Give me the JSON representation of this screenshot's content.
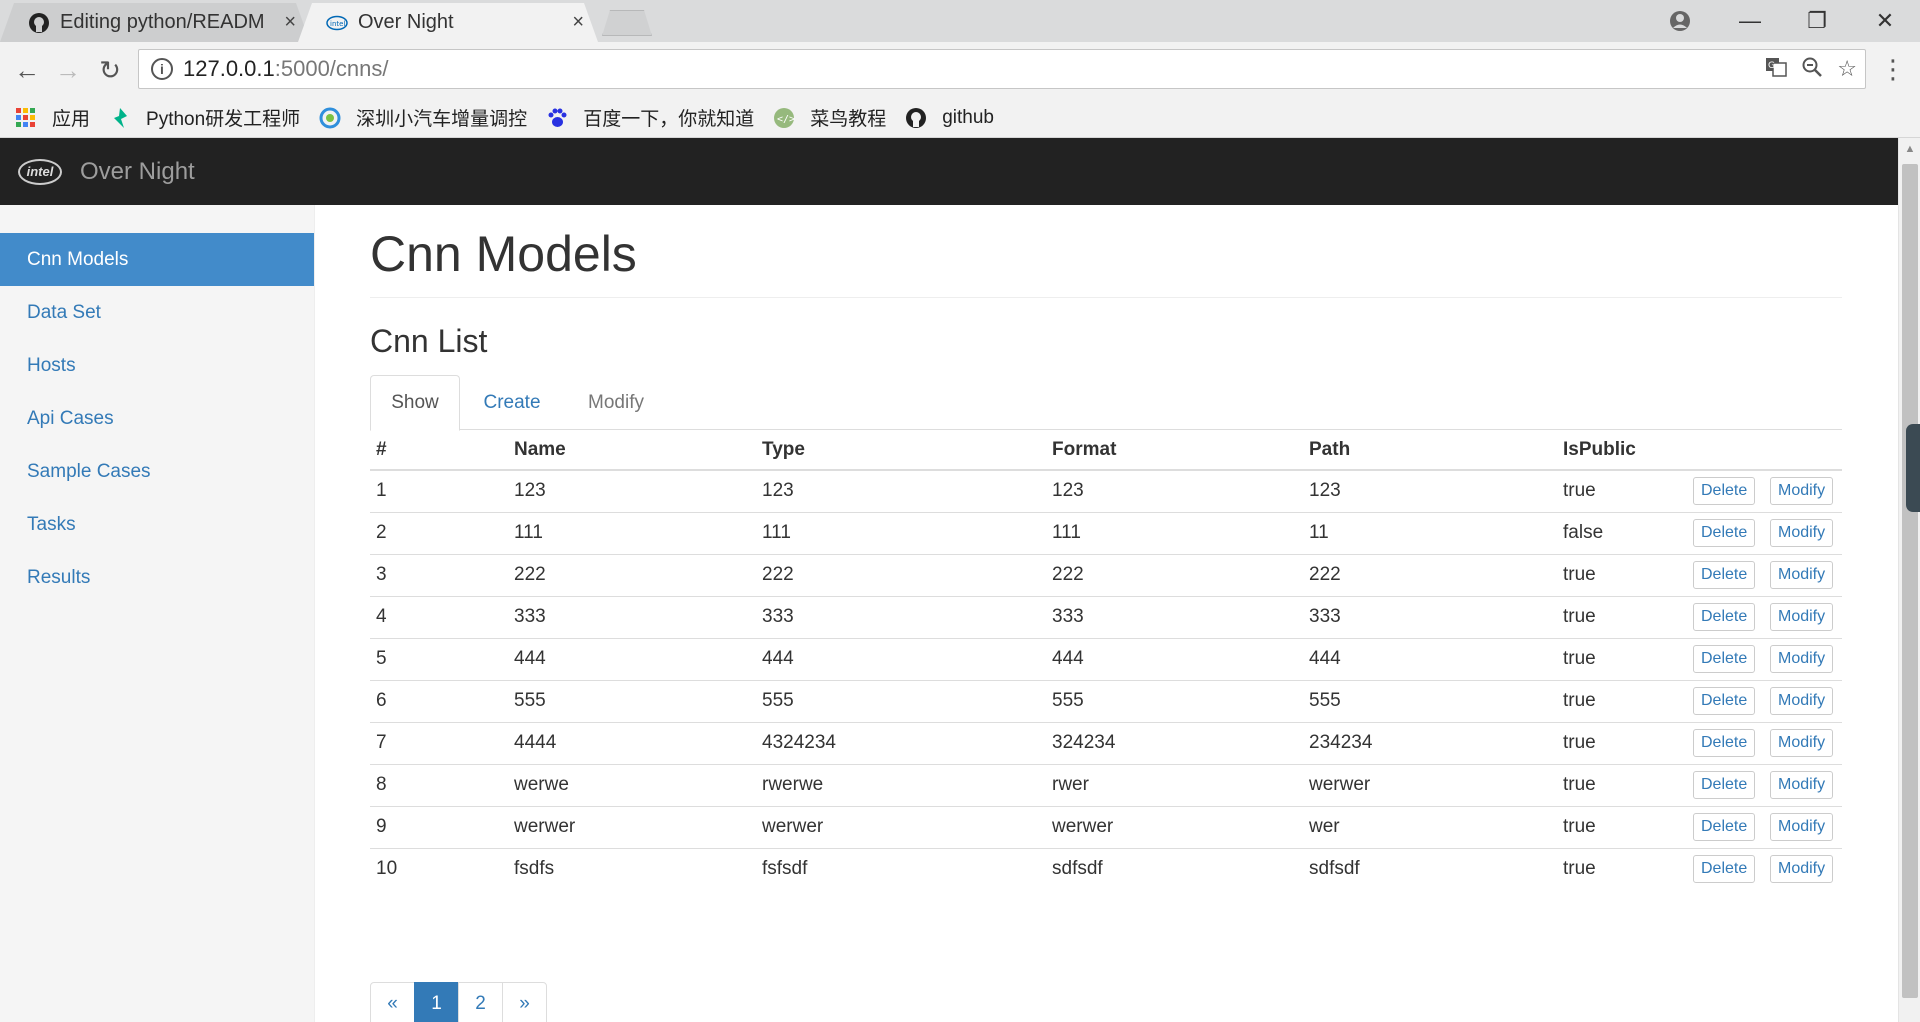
{
  "browser": {
    "tabs": [
      {
        "title": "Editing python/READM",
        "close": "×"
      },
      {
        "title": "Over Night",
        "close": "×"
      }
    ],
    "window_controls": {
      "minimize": "—",
      "restore": "❐",
      "close": "✕"
    },
    "url_host": "127.0.0.1",
    "url_path": ":5000/cnns/",
    "bookmarks": [
      {
        "label": "应用",
        "icon": "apps-grid-icon"
      },
      {
        "label": "Python研发工程师",
        "icon": "leaf-icon"
      },
      {
        "label": "深圳小汽车增量调控",
        "icon": "globe-icon"
      },
      {
        "label": "百度一下，你就知道",
        "icon": "paw-icon"
      },
      {
        "label": "菜鸟教程",
        "icon": "code-icon"
      },
      {
        "label": "github",
        "icon": "github-icon"
      }
    ]
  },
  "navbar": {
    "brand_logo": "intel",
    "brand": "Over Night"
  },
  "sidebar": {
    "items": [
      {
        "label": "Cnn Models",
        "active": true
      },
      {
        "label": "Data Set"
      },
      {
        "label": "Hosts"
      },
      {
        "label": "Api Cases"
      },
      {
        "label": "Sample Cases"
      },
      {
        "label": "Tasks"
      },
      {
        "label": "Results"
      }
    ]
  },
  "main": {
    "title": "Cnn Models",
    "subtitle": "Cnn List",
    "tabs": [
      {
        "label": "Show"
      },
      {
        "label": "Create"
      },
      {
        "label": "Modify"
      }
    ],
    "table": {
      "columns": [
        "#",
        "Name",
        "Type",
        "Format",
        "Path",
        "IsPublic"
      ],
      "delete_label": "Delete",
      "modify_label": "Modify",
      "rows": [
        [
          "1",
          "123",
          "123",
          "123",
          "123",
          "true"
        ],
        [
          "2",
          "111",
          "111",
          "111",
          "11",
          "false"
        ],
        [
          "3",
          "222",
          "222",
          "222",
          "222",
          "true"
        ],
        [
          "4",
          "333",
          "333",
          "333",
          "333",
          "true"
        ],
        [
          "5",
          "444",
          "444",
          "444",
          "444",
          "true"
        ],
        [
          "6",
          "555",
          "555",
          "555",
          "555",
          "true"
        ],
        [
          "7",
          "4444",
          "4324234",
          "324234",
          "234234",
          "true"
        ],
        [
          "8",
          "werwe",
          "rwerwe",
          "rwer",
          "werwer",
          "true"
        ],
        [
          "9",
          "werwer",
          "werwer",
          "werwer",
          "wer",
          "true"
        ],
        [
          "10",
          "fsdfs",
          "fsfsdf",
          "sdfsdf",
          "sdfsdf",
          "true"
        ]
      ]
    },
    "pagination": {
      "prev": "«",
      "pages": [
        "1",
        "2"
      ],
      "current": "1",
      "next": "»"
    }
  },
  "colors": {
    "navbar_bg": "#222222",
    "sidebar_active": "#428bca",
    "link": "#337ab7"
  }
}
